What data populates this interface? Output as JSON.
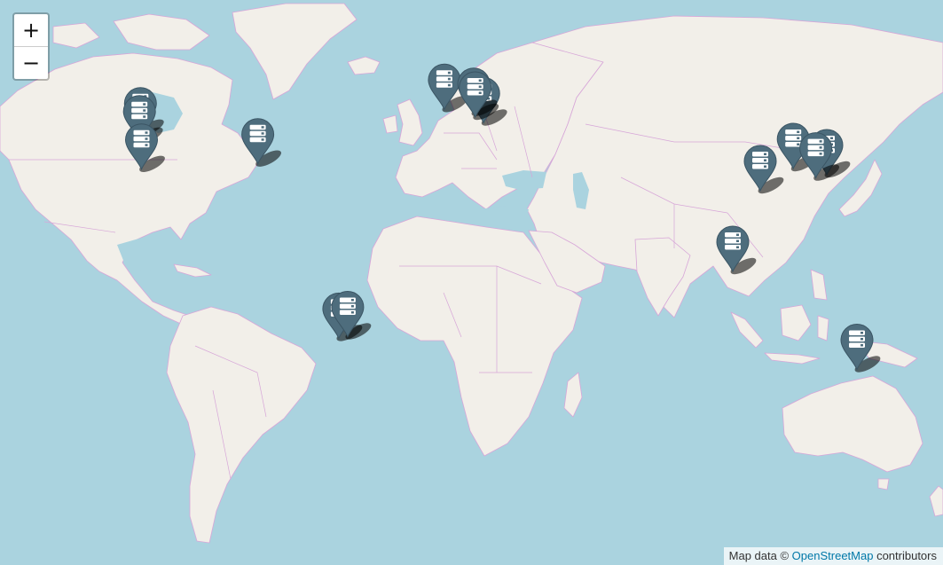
{
  "map": {
    "zoom_in_label": "+",
    "zoom_out_label": "−",
    "attribution_prefix": "Map data © ",
    "attribution_link": "OpenStreetMap",
    "attribution_suffix": " contributors",
    "colors": {
      "water": "#aad3df",
      "land": "#f2efe9",
      "border": "#d7a6d8",
      "marker": "#4e6d7d",
      "marker_shadow": "#000000"
    },
    "marker_icon": "server-icon",
    "markers": [
      {
        "lat": 47.6,
        "lon": -122.3
      },
      {
        "lat": 45.5,
        "lon": -122.7
      },
      {
        "lat": 37.4,
        "lon": -121.9
      },
      {
        "lat": 39.0,
        "lon": -77.5
      },
      {
        "lat": 53.3,
        "lon": -6.3
      },
      {
        "lat": 50.1,
        "lon": 8.7
      },
      {
        "lat": 52.4,
        "lon": 4.9
      },
      {
        "lat": 51.5,
        "lon": 5.5
      },
      {
        "lat": 30.6,
        "lon": 114.3
      },
      {
        "lat": 37.6,
        "lon": 126.9
      },
      {
        "lat": 35.7,
        "lon": 139.7
      },
      {
        "lat": 34.7,
        "lon": 135.5
      },
      {
        "lat": 1.35,
        "lon": 103.8
      },
      {
        "lat": -23.5,
        "lon": -46.6
      },
      {
        "lat": -22.9,
        "lon": -43.2
      },
      {
        "lat": -33.9,
        "lon": 151.2
      }
    ]
  }
}
